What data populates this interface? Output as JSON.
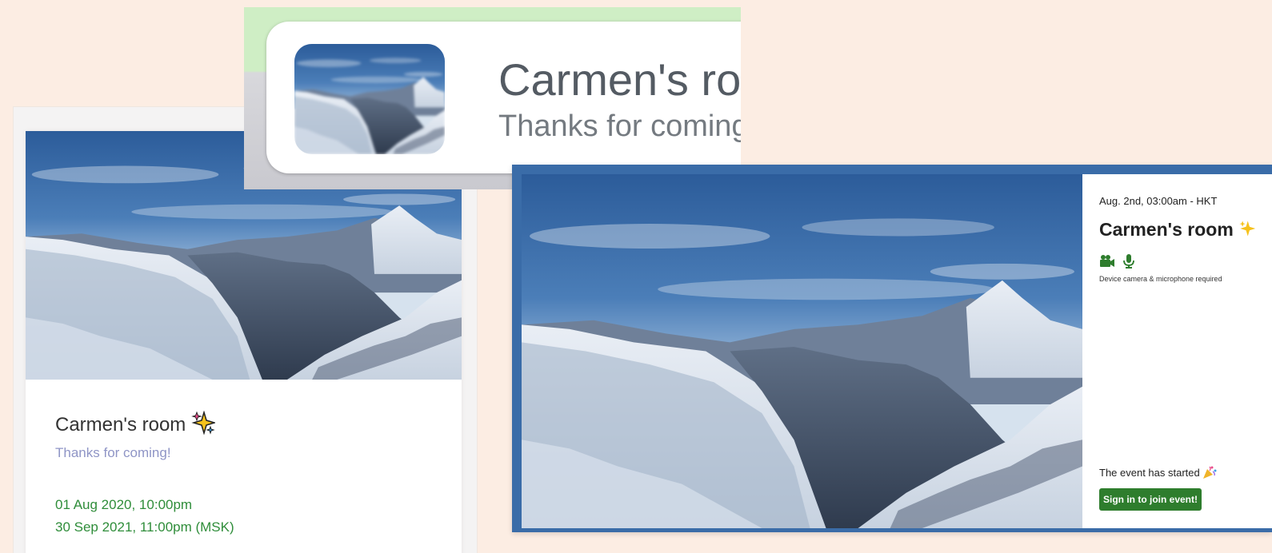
{
  "left_card": {
    "title": "Carmen's room",
    "subtitle": "Thanks for coming!",
    "dates": [
      "01 Aug 2020, 10:00pm",
      "30 Sep 2021, 11:00pm (MSK)"
    ]
  },
  "banner": {
    "title": "Carmen's room",
    "subtitle": "Thanks for coming!"
  },
  "event": {
    "date": "Aug. 2nd, 03:00am - HKT",
    "title": "Carmen's room",
    "requirement": "Device camera & microphone required",
    "status": "The event has started",
    "join_button": "Sign in to join event!",
    "icons": [
      "camera-icon",
      "microphone-icon",
      "sparkles-icon",
      "party-popper-icon"
    ]
  },
  "colors": {
    "background": "#fcede3",
    "date_green": "#2f8d3a",
    "subtitle_purple": "#8f95c6",
    "button_green": "#2e7d2d"
  }
}
